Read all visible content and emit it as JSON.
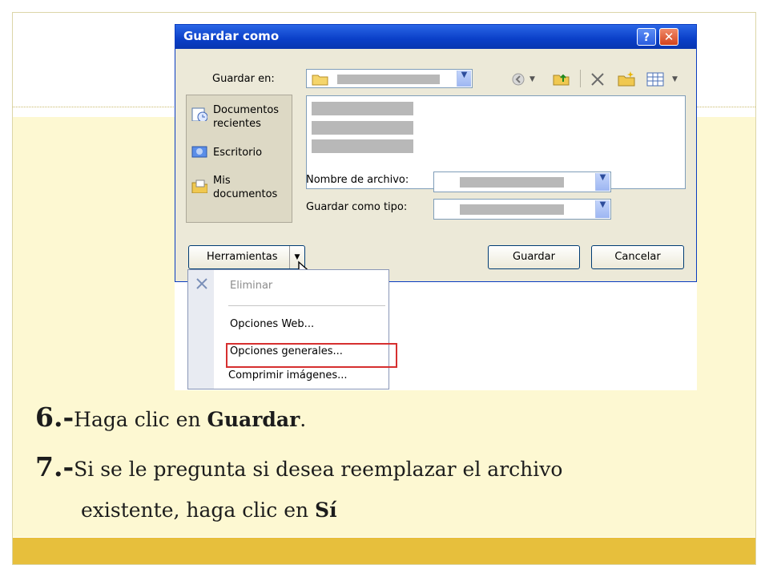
{
  "dialog": {
    "title": "Guardar como",
    "help_label": "?",
    "close_label": "✕",
    "save_in_label": "Guardar en:",
    "places": [
      {
        "label_line1": "Documentos",
        "label_line2": "recientes",
        "icon": "recent-documents-icon"
      },
      {
        "label_line1": "Escritorio",
        "label_line2": "",
        "icon": "desktop-icon"
      },
      {
        "label_line1": "Mis",
        "label_line2": "documentos",
        "icon": "my-documents-icon"
      }
    ],
    "file_name_label": "Nombre de archivo:",
    "file_type_label": "Guardar como tipo:",
    "tools_button": "Herramientas",
    "save_button": "Guardar",
    "cancel_button": "Cancelar"
  },
  "tools_menu": {
    "items": [
      {
        "label": "Eliminar",
        "enabled": false
      },
      {
        "label": "Opciones Web...",
        "enabled": true
      },
      {
        "label": "Opciones generales...",
        "enabled": true,
        "highlighted": true
      },
      {
        "label": "Comprimir imágenes...",
        "enabled": true
      }
    ]
  },
  "instructions": [
    {
      "number": "6.-",
      "parts": [
        "Haga clic en ",
        "Guardar",
        "."
      ]
    },
    {
      "number": "7.-",
      "line1": "Si se le pregunta si desea reemplazar el archivo",
      "line2_text": "existente, haga clic en ",
      "line2_bold": "Sí"
    }
  ],
  "colors": {
    "slide_background": "#fdf8d2",
    "footer_band": "#e7bf3c",
    "titlebar": "#0a3fc8",
    "highlight_box": "#d62f2f"
  }
}
